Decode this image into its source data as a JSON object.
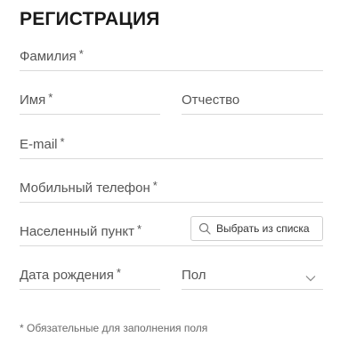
{
  "form": {
    "title": "РЕГИСТРАЦИЯ",
    "required_mark": "*",
    "fields": {
      "lastname": {
        "label": "Фамилия",
        "required": true
      },
      "firstname": {
        "label": "Имя",
        "required": true
      },
      "patronymic": {
        "label": "Отчество",
        "required": false
      },
      "email": {
        "label": "E-mail",
        "required": true
      },
      "phone": {
        "label": "Мобильный телефон",
        "required": true
      },
      "city": {
        "label": "Населенный пункт",
        "required": true
      },
      "birthdate": {
        "label": "Дата рождения",
        "required": true
      },
      "gender": {
        "label": "Пол",
        "required": false
      }
    },
    "select_from_list": "Выбрать из списка",
    "required_note": "* Обязательные для заполнения поля"
  },
  "icons": {
    "search": "search-icon",
    "chevron": "chevron-down-icon"
  }
}
